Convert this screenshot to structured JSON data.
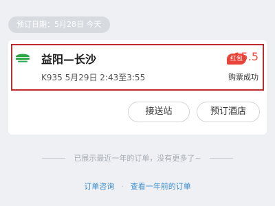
{
  "booking_date": "预订日期：5月28日 今天",
  "order": {
    "icon": "train-icon",
    "route": "益阳—长沙",
    "currency": "¥",
    "price": "15.5",
    "train_info": "K935   5月29日 2:43至3:55",
    "status": "购票成功"
  },
  "actions": {
    "pickup_label": "接送站",
    "hotel_label": "预订酒店",
    "hotel_badge": "红包"
  },
  "footer": {
    "end_message": "已展示最近一年的订单，没有更多了~",
    "link_consult": "订单咨询",
    "separator": "·",
    "link_older": "查看一年前的订单"
  },
  "colors": {
    "highlight_border": "#c0292b",
    "icon_green": "#2ea64a",
    "price_red": "#f04a3e",
    "link_blue": "#3c8fd0"
  }
}
